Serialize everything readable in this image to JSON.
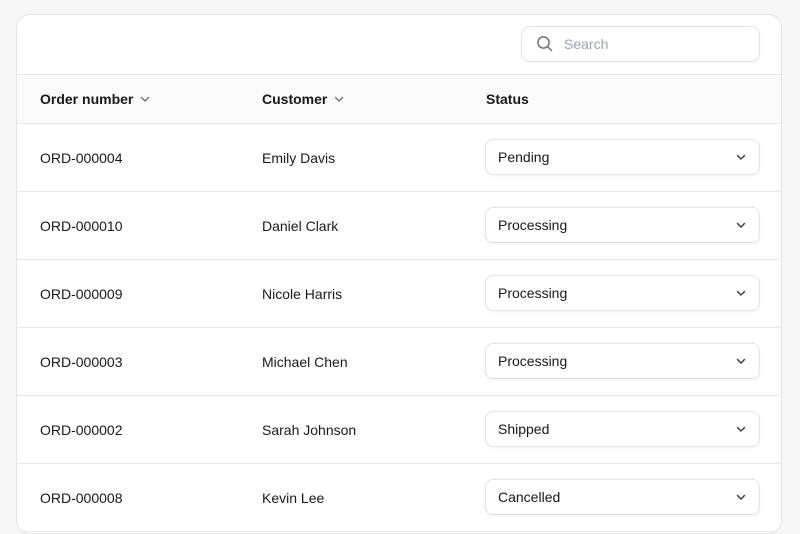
{
  "search": {
    "placeholder": "Search",
    "icon": "search-icon"
  },
  "table": {
    "columns": [
      {
        "label": "Order number",
        "sortable": true
      },
      {
        "label": "Customer",
        "sortable": true
      },
      {
        "label": "Status",
        "sortable": false
      }
    ],
    "rows": [
      {
        "order": "ORD-000004",
        "customer": "Emily Davis",
        "status": "Pending"
      },
      {
        "order": "ORD-000010",
        "customer": "Daniel Clark",
        "status": "Processing"
      },
      {
        "order": "ORD-000009",
        "customer": "Nicole Harris",
        "status": "Processing"
      },
      {
        "order": "ORD-000003",
        "customer": "Michael Chen",
        "status": "Processing"
      },
      {
        "order": "ORD-000002",
        "customer": "Sarah Johnson",
        "status": "Shipped"
      },
      {
        "order": "ORD-000008",
        "customer": "Kevin Lee",
        "status": "Cancelled"
      }
    ]
  },
  "colors": {
    "border": "#e8e8eb",
    "header_bg": "#fafafa",
    "text": "#18181b",
    "muted": "#9ca3af"
  }
}
